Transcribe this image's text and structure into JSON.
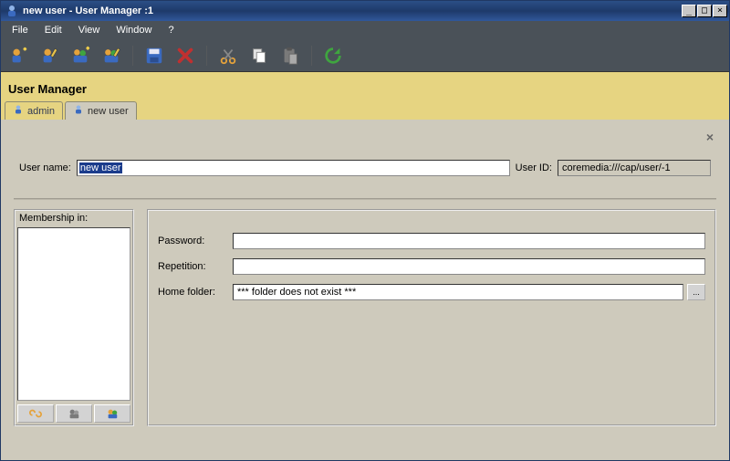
{
  "window": {
    "title": "new user - User Manager :1"
  },
  "menu": {
    "file": "File",
    "edit": "Edit",
    "view": "View",
    "window": "Window",
    "help": "?"
  },
  "toolbar_icons": {
    "new_user": "new-user-icon",
    "edit_user": "edit-user-icon",
    "new_group": "new-group-icon",
    "edit_group": "edit-group-icon",
    "save": "save-icon",
    "delete": "delete-icon",
    "cut": "cut-icon",
    "copy": "copy-icon",
    "paste": "paste-icon",
    "refresh": "refresh-icon"
  },
  "header": {
    "title": "User Manager",
    "tabs": [
      {
        "label": "admin"
      },
      {
        "label": "new user"
      }
    ]
  },
  "form": {
    "username_label": "User name:",
    "username_value": "new user",
    "userid_label": "User ID:",
    "userid_value": "coremedia:///cap/user/-1",
    "membership_label": "Membership in:",
    "password_label": "Password:",
    "password_value": "",
    "repetition_label": "Repetition:",
    "repetition_value": "",
    "homefolder_label": "Home folder:",
    "homefolder_value": "*** folder does not exist ***",
    "browse_label": "..."
  }
}
